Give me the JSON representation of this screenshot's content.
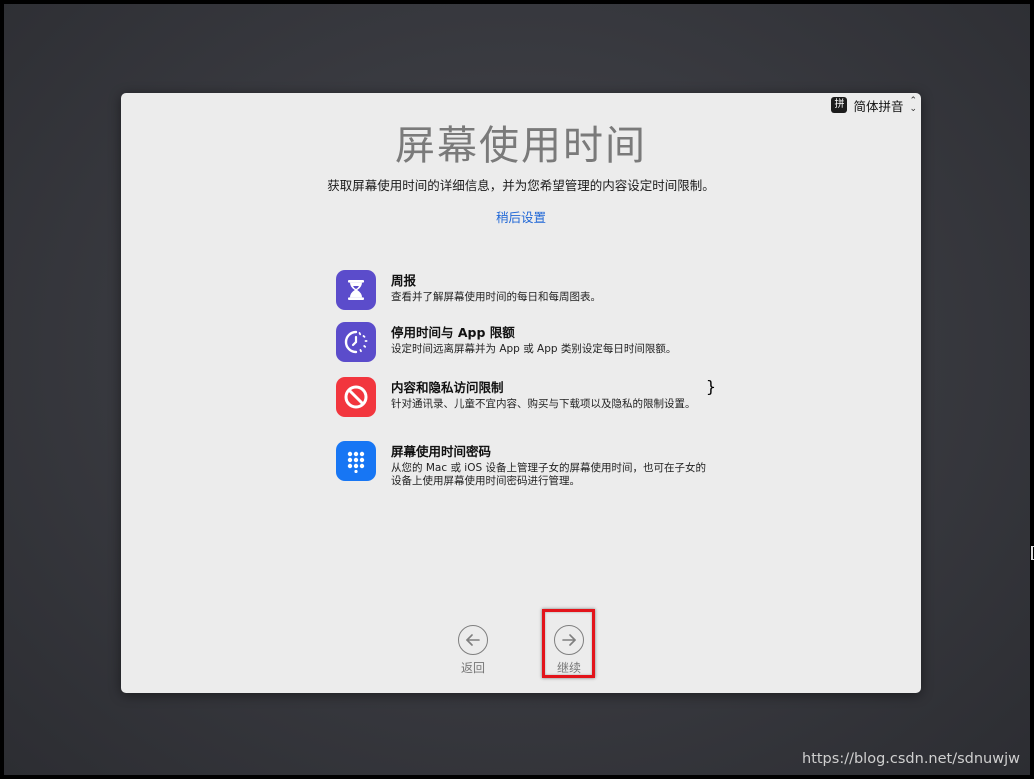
{
  "input_method": {
    "badge": "拼",
    "label": "简体拼音",
    "chevron_up": "⌃",
    "chevron_down": "⌄"
  },
  "page": {
    "title": "屏幕使用时间",
    "subtitle": "获取屏幕使用时间的详细信息，并为您希望管理的内容设定时间限制。",
    "later_link": "稍后设置"
  },
  "features": [
    {
      "title": "周报",
      "description": "查看并了解屏幕使用时间的每日和每周图表。",
      "icon": "hourglass-icon",
      "color": "#5b4ccb"
    },
    {
      "title": "停用时间与 App 限额",
      "description": "设定时间远离屏幕并为 App 或 App 类别设定每日时间限额。",
      "icon": "downtime-timer-icon",
      "color": "#5b4ccb"
    },
    {
      "title": "内容和隐私访问限制",
      "description": "针对通讯录、儿童不宜内容、购买与下载项以及隐私的限制设置。",
      "icon": "no-entry-icon",
      "color": "#f2363e"
    },
    {
      "title": "屏幕使用时间密码",
      "description": "从您的 Mac 或 iOS 设备上管理子女的屏幕使用时间，也可在子女的设备上使用屏幕使用时间密码进行管理。",
      "icon": "keypad-icon",
      "color": "#1776f4"
    }
  ],
  "navigation": {
    "back_label": "返回",
    "continue_label": "继续"
  },
  "watermark": "https://blog.csdn.net/sdnuwjw",
  "colors": {
    "highlight_border": "#e3141b",
    "link": "#2067d6",
    "panel_background": "#ececec"
  }
}
